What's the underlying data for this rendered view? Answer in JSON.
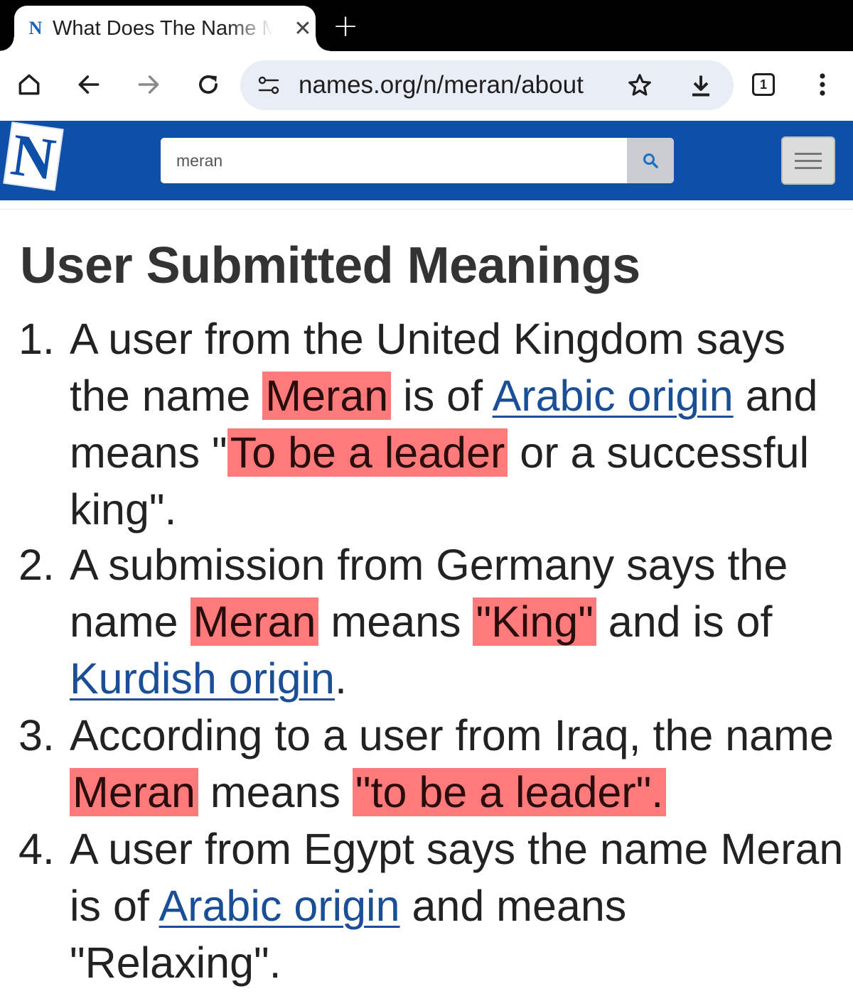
{
  "browser": {
    "tab_title": "What Does The Name Meran Mean?",
    "close_glyph": "✕",
    "new_tab_glyph": "+",
    "url": "names.org/n/meran/about",
    "tab_count": "1",
    "icons": [
      "home-icon",
      "back-icon",
      "forward-icon",
      "reload-icon",
      "site-settings-icon",
      "star-icon",
      "download-icon",
      "tab-count-icon",
      "more-icon"
    ]
  },
  "site": {
    "logo": "N",
    "search_value": "meran",
    "search_icon": "search-icon",
    "menu_icon": "hamburger-icon",
    "brand_color": "#0e4fa8",
    "highlight_color": "#ff7b7b",
    "link_color": "#1a4f97"
  },
  "page": {
    "heading": "User Submitted Meanings",
    "items": [
      {
        "num": "1.",
        "t1": "A user from the United Kingdom says the name ",
        "hl1": "Meran",
        "t2": " is of ",
        "link": "Arabic origin",
        "t3": " and means \"",
        "hl2": "To be a leader",
        "t4": " or a successful king\"."
      },
      {
        "num": "2.",
        "t1": "A submission from Germany says the name ",
        "hl1": "Meran",
        "t2": " means ",
        "hl2": "\"King\"",
        "t3": " and is of ",
        "link": "Kurdish origin",
        "t4": "."
      },
      {
        "num": "3.",
        "t1": "According to a user from Iraq, the name ",
        "hl1": "Meran",
        "t2": " means ",
        "hl2": "\"to be a leader\"."
      },
      {
        "num": "4.",
        "t1": "A user from Egypt says the name Meran is of ",
        "link": "Arabic origin",
        "t2": " and means \"Relaxing\"."
      }
    ]
  }
}
